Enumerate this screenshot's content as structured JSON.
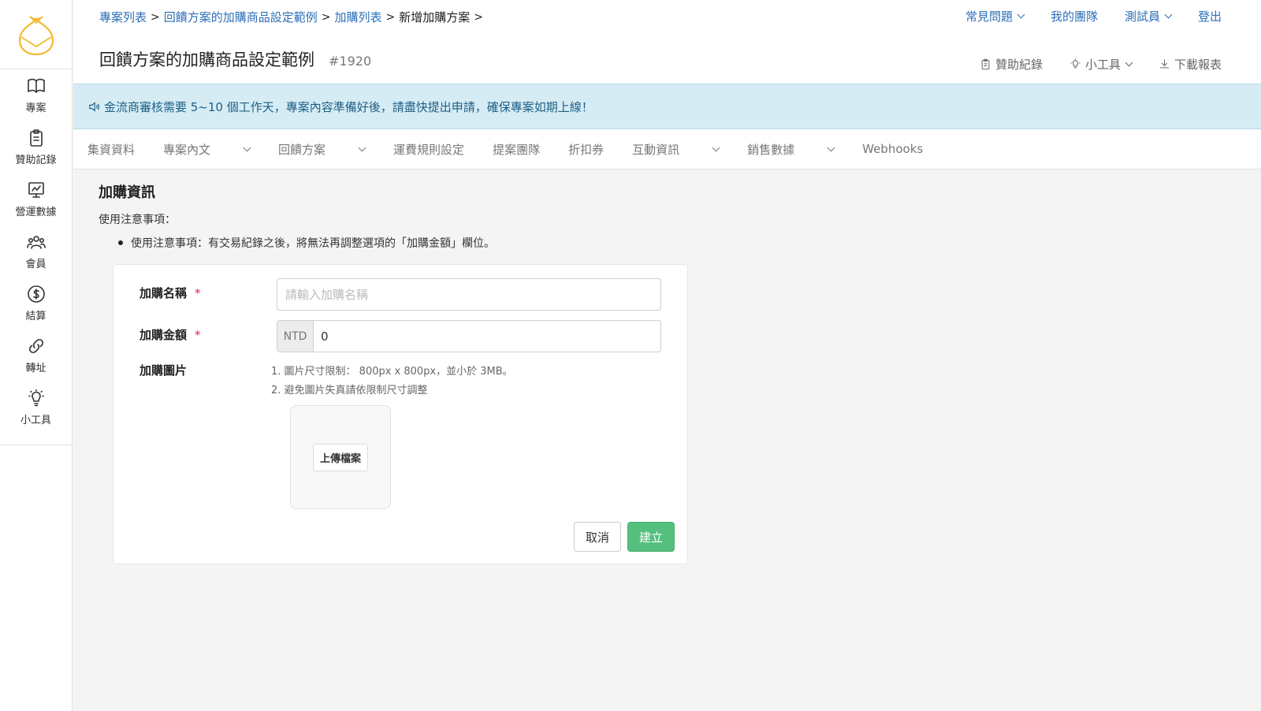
{
  "colors": {
    "link": "#2c6fb7",
    "accent_green": "#55c07e",
    "notice_bg": "#d6ecf4",
    "required": "#e2244a",
    "logo": "#f5b82e"
  },
  "sidebar": {
    "items": [
      {
        "label": "專案",
        "icon": "book-icon"
      },
      {
        "label": "贊助記錄",
        "icon": "clipboard-icon"
      },
      {
        "label": "營運數據",
        "icon": "chart-icon"
      },
      {
        "label": "會員",
        "icon": "users-icon"
      },
      {
        "label": "結算",
        "icon": "dollar-icon"
      },
      {
        "label": "轉址",
        "icon": "link-icon"
      },
      {
        "label": "小工具",
        "icon": "lightbulb-icon"
      }
    ]
  },
  "breadcrumb": {
    "items": [
      "專案列表",
      "回饋方案的加購商品設定範例",
      "加購列表"
    ],
    "current": "新增加購方案"
  },
  "topnav": {
    "faq": "常見問題",
    "team": "我的團隊",
    "user": "測試員",
    "logout": "登出"
  },
  "page": {
    "title": "回饋方案的加購商品設定範例",
    "id": "#1920"
  },
  "tools": {
    "sponsor_log": "贊助紀錄",
    "widgets": "小工具",
    "download": "下載報表"
  },
  "notice": "金流商審核需要 5~10 個工作天，專案內容準備好後，請盡快提出申請，確保專案如期上線！",
  "tabs": [
    {
      "label": "集資資料",
      "dropdown": false
    },
    {
      "label": "專案內文",
      "dropdown": true
    },
    {
      "label": "回饋方案",
      "dropdown": true
    },
    {
      "label": "運費規則設定",
      "dropdown": false
    },
    {
      "label": "提案團隊",
      "dropdown": false
    },
    {
      "label": "折扣券",
      "dropdown": false
    },
    {
      "label": "互動資訊",
      "dropdown": true
    },
    {
      "label": "銷售數據",
      "dropdown": true
    },
    {
      "label": "Webhooks",
      "dropdown": false
    }
  ],
  "form": {
    "section_title": "加購資訊",
    "notes_label": "使用注意事項：",
    "note": "使用注意事項：有交易紀錄之後，將無法再調整選項的「加購金額」欄位。",
    "name_label": "加購名稱",
    "name_placeholder": "請輸入加購名稱",
    "price_label": "加購金額",
    "currency": "NTD",
    "price_value": "0",
    "image_label": "加購圖片",
    "image_note_1": "1. 圖片尺寸限制： 800px x 800px，並小於 3MB。",
    "image_note_2": "2. 避免圖片失真請依限制尺寸調整",
    "upload_label": "上傳檔案",
    "cancel": "取消",
    "create": "建立",
    "required_mark": "*"
  }
}
